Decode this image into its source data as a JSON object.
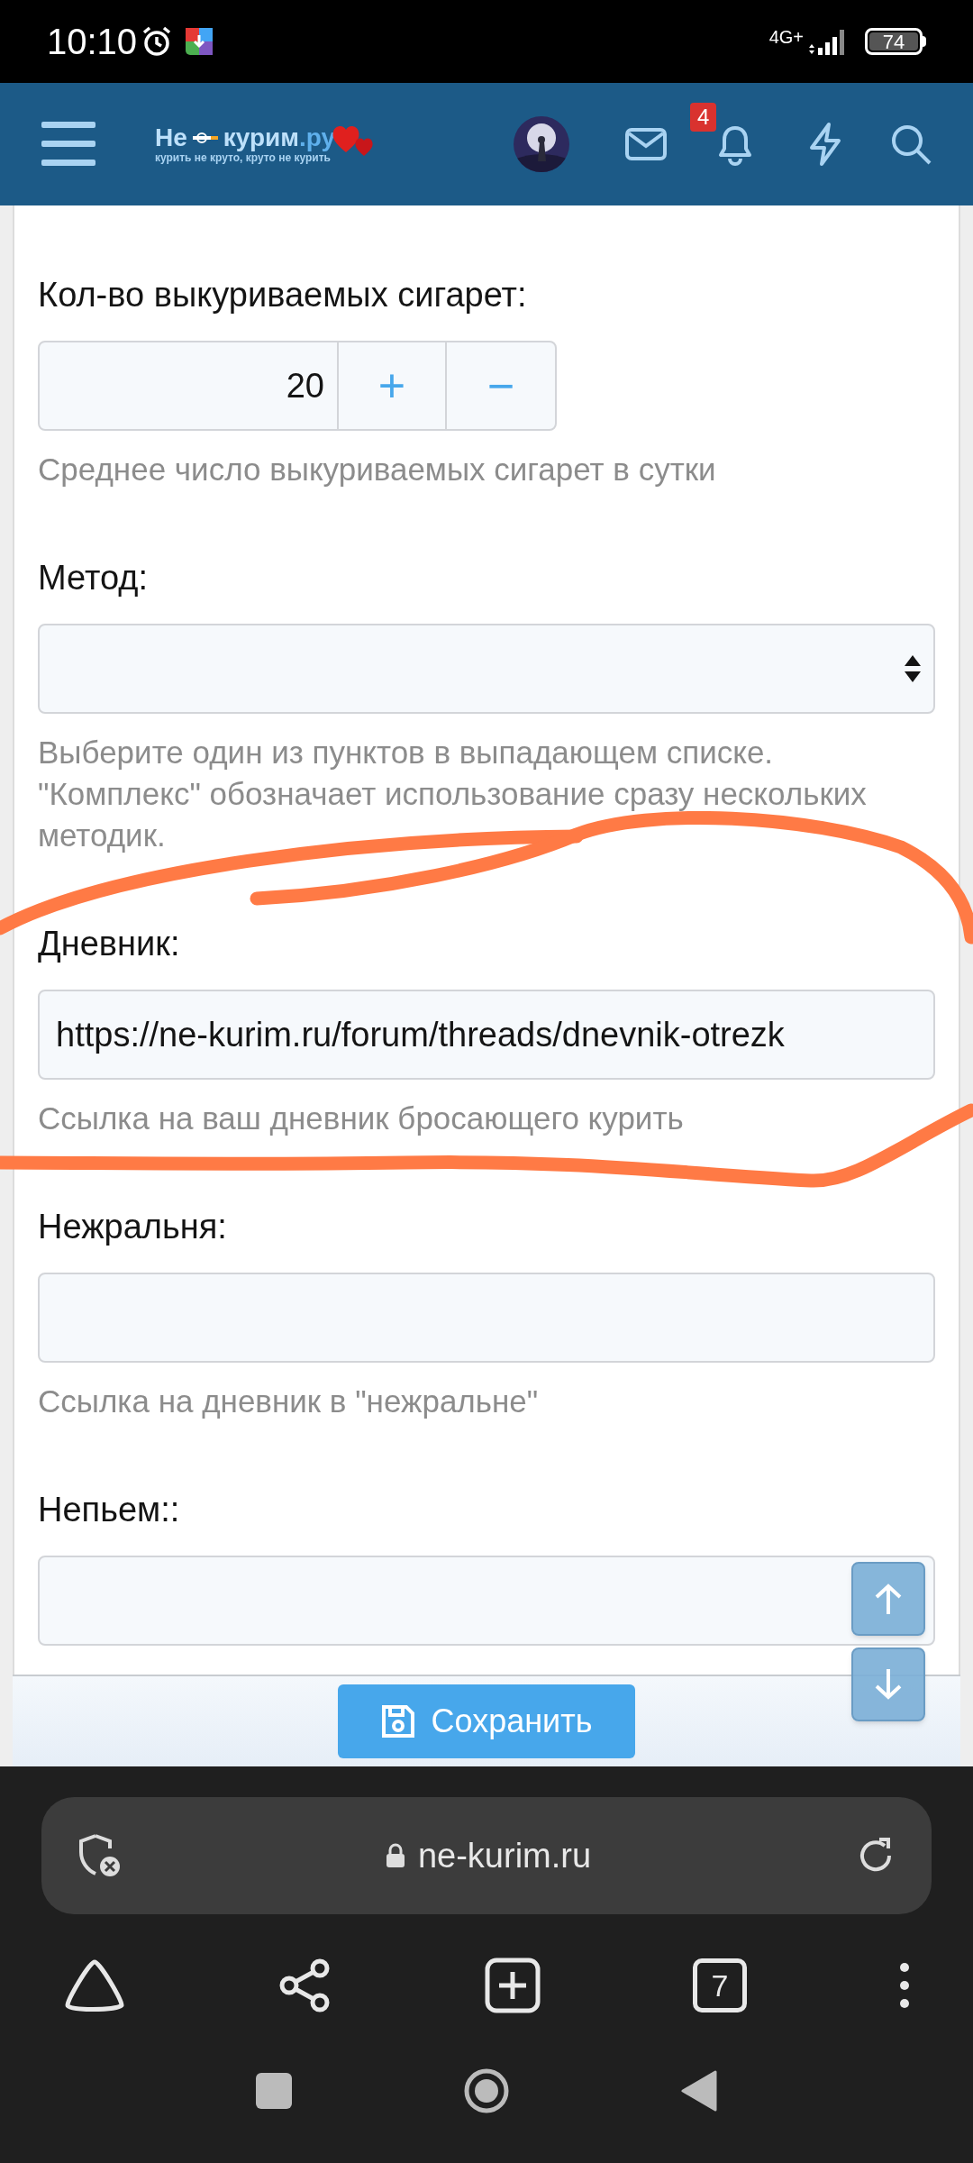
{
  "status_bar": {
    "time": "10:10",
    "network": "4G+",
    "battery": "74"
  },
  "header": {
    "logo": {
      "word_1": "Не",
      "word_2": "курим",
      "suffix": ".ру",
      "tagline": "курить не круто, круто не курить"
    },
    "notification_count": "4"
  },
  "fields": [
    {
      "kind": "number",
      "label": "Кол-во выкуриваемых сигарет:",
      "value": "20",
      "plus": "+",
      "minus": "−",
      "hint": "Среднее число выкуриваемых сигарет в сутки"
    },
    {
      "kind": "select",
      "label": "Метод:",
      "hint": "Выберите один из пунктов в выпадающем списке. \"Комплекс\" обозначает использование сразу нескольких методик."
    },
    {
      "kind": "text",
      "label": "Дневник:",
      "value": "https://ne-kurim.ru/forum/threads/dnevnik-otrezk",
      "hint": "Ссылка на ваш дневник бросающего курить"
    },
    {
      "kind": "text",
      "label": "Нежральня:",
      "hint": "Ссылка на дневник в \"нежральне\""
    },
    {
      "kind": "text",
      "label": "Непьем::"
    }
  ],
  "save_button": {
    "label": "Сохранить"
  },
  "browser": {
    "url": "ne-kurim.ru",
    "tab_count": "7"
  }
}
